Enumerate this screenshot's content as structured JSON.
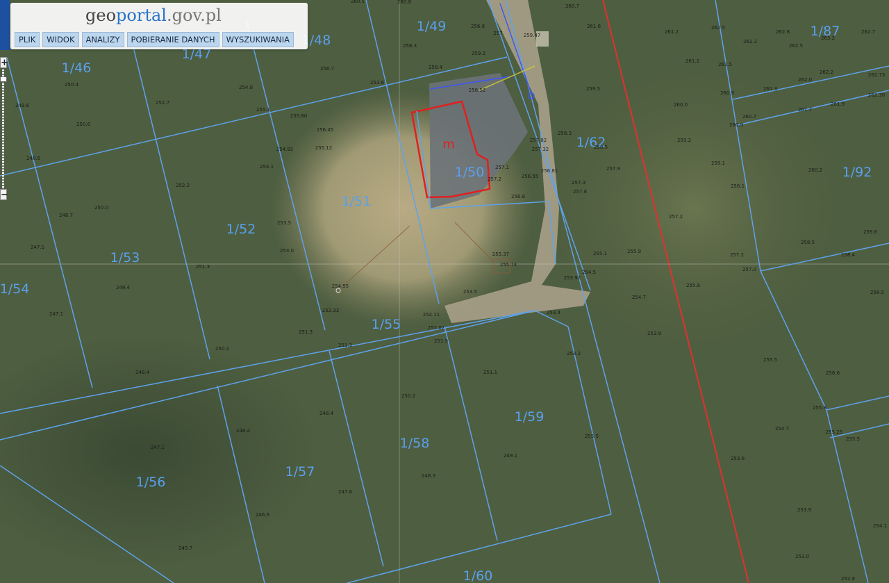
{
  "app": {
    "logo": {
      "pre": "g",
      "mid1": "eo",
      "mid2": "portal",
      "post": ".gov.pl"
    },
    "menu": [
      "PLIK",
      "WIDOK",
      "ANALIZY",
      "POBIERANIE DANYCH",
      "WYSZUKIWANIA"
    ]
  },
  "zoom": {
    "in_label": "+",
    "out_label": "−"
  },
  "map": {
    "building_label": "m",
    "parcels": [
      {
        "label": "1/46"
      },
      {
        "label": "1/47"
      },
      {
        "label": "1/48"
      },
      {
        "label": "1/49"
      },
      {
        "label": "1/87"
      },
      {
        "label": "1/62"
      },
      {
        "label": "1/92"
      },
      {
        "label": "1/50"
      },
      {
        "label": "1/51"
      },
      {
        "label": "1/52"
      },
      {
        "label": "1/53"
      },
      {
        "label": "1/54"
      },
      {
        "label": "1/55"
      },
      {
        "label": "1/59"
      },
      {
        "label": "1/58"
      },
      {
        "label": "1/57"
      },
      {
        "label": "1/56"
      },
      {
        "label": "1/60"
      }
    ],
    "elevations": [
      "260.5",
      "260.8",
      "260.7",
      "261.6",
      "261.2",
      "262.5",
      "262.8",
      "263.2",
      "262.2",
      "262.5",
      "262.7",
      "262.2",
      "262.0",
      "261.7",
      "261.9",
      "262.73",
      "262.30",
      "256.8",
      "258.3",
      "259.2",
      "258.4",
      "253.6",
      "259.47",
      "261.2",
      "261.5",
      "260.9",
      "260.7",
      "261.3",
      "260.9",
      "256.7",
      "257",
      "258.52",
      "259.5",
      "260.0",
      "259.2",
      "259.1",
      "258.1",
      "260.2",
      "250.4",
      "249.6",
      "252.7",
      "254.8",
      "255.1",
      "255.80",
      "256.45",
      "255.12",
      "254.92",
      "254.1",
      "257.82",
      "257.32",
      "258.3",
      "258.5",
      "257.9",
      "250.6",
      "248.6",
      "252.2",
      "250.0",
      "253.5",
      "253.0",
      "257.1",
      "257.2",
      "256.81",
      "256.55",
      "257.3",
      "257.8",
      "256.8",
      "257.2",
      "258.5",
      "259.6",
      "248.7",
      "247.1",
      "251.3",
      "249.4",
      "247.1",
      "255.37",
      "255.74",
      "253.92",
      "254.5",
      "255.1",
      "255.9",
      "257.2",
      "257.0",
      "258.4",
      "258.5",
      "254.55",
      "252.33",
      "253.5",
      "252.11",
      "252.02",
      "251.9",
      "253.4",
      "251.3",
      "251.3",
      "250.1",
      "248.4",
      "254.7",
      "255.8",
      "253.9",
      "255.5",
      "256.6",
      "255.8",
      "255.25",
      "255.5",
      "251.1",
      "253.2",
      "250.2",
      "248.4",
      "248.4",
      "247.1",
      "247.6",
      "246.6",
      "245.7",
      "249.1",
      "248.3",
      "253.6",
      "254.7",
      "255.5",
      "253.9",
      "253.0",
      "252.8",
      "254.1"
    ]
  }
}
